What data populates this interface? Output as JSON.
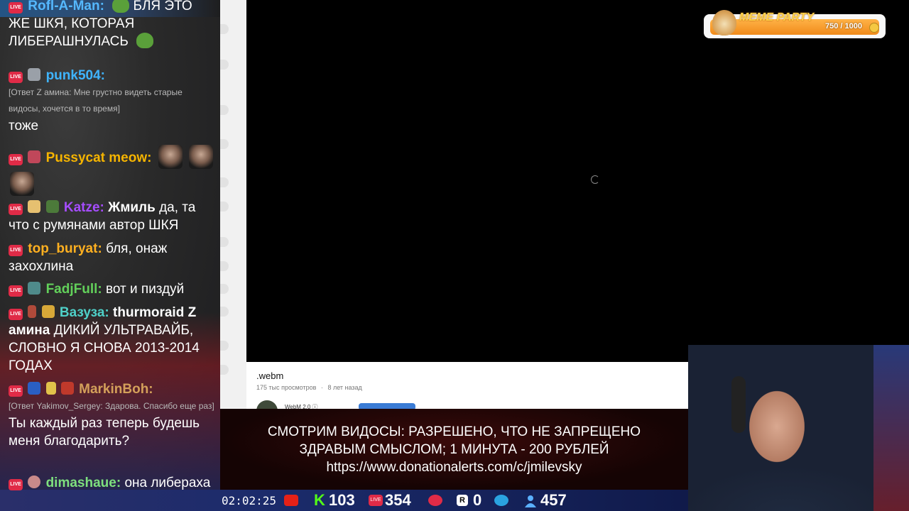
{
  "chat": {
    "messages": [
      {
        "nick": "Rofl-A-Man:",
        "text": "БЛЯ ЭТО ЖЕ ШКЯ, КОТОРАЯ ЛИБЕРАШНУЛАСЬ"
      },
      {
        "nick": "punk504:",
        "reply": "[Ответ Z амина: Мне грустно видеть старые видосы, хочется в то время]",
        "text": "тоже"
      },
      {
        "nick": "Pussycat meow:",
        "text": ""
      },
      {
        "nick": "Katze:",
        "bold": "Жмиль",
        "text": "да, та что с румянами автор ШКЯ"
      },
      {
        "nick": "top_buryat:",
        "text": "бля, онаж захохлина"
      },
      {
        "nick": "FadjFull:",
        "text": "вот и пиздуй"
      },
      {
        "nick": "Вазуза:",
        "bold": "thurmoraid Z амина",
        "text": "ДИКИЙ УЛЬТРАВАЙБ, СЛОВНО Я СНОВА 2013-2014 ГОДАХ"
      },
      {
        "nick": "MarkinBoh:",
        "reply": "[Ответ Yakimov_Sergey: Здарова. Спасибо еще раз]",
        "text": "Ты каждый раз теперь будешь меня благодарить?"
      },
      {
        "nick": "dimashaue:",
        "text": "она либераха вроде"
      }
    ],
    "live_badge": "LIVE",
    "colors": {
      "rofl": "#55b8ff",
      "punk": "#3fb4ff",
      "pussy": "#f5b400",
      "katze": "#a64dff",
      "top": "#ffb020",
      "fadj": "#62d05a",
      "vazuza": "#4fd0c8",
      "markin": "#d4a05a",
      "dima": "#7ee07e"
    }
  },
  "video": {
    "title": ".webm",
    "views": "175 тыс просмотров",
    "age": "8 лет назад",
    "channel": "WebM 2.0 ⓘ"
  },
  "overlay": {
    "meme_title": "MEME PARTY",
    "meme_progress": "750 / 1000",
    "meme_fraction": 0.75
  },
  "banner": {
    "line1": "СМОТРИМ ВИДОСЫ: РАЗРЕШЕНО, ЧТО НЕ ЗАПРЕЩЕНО",
    "line2": "ЗДРАВЫМ СМЫСЛОМ; 1 МИНУТА - 200 РУБЛЕЙ",
    "line3": "https://www.donationalerts.com/c/jmilevsky"
  },
  "status": {
    "timer": "02:02:25",
    "kick_count": "103",
    "vk_count": "354",
    "rumble_count": "0",
    "viewer_count": "457",
    "kick_letter": "K",
    "rumble_letter": "R",
    "vk_label": "LIVE"
  }
}
